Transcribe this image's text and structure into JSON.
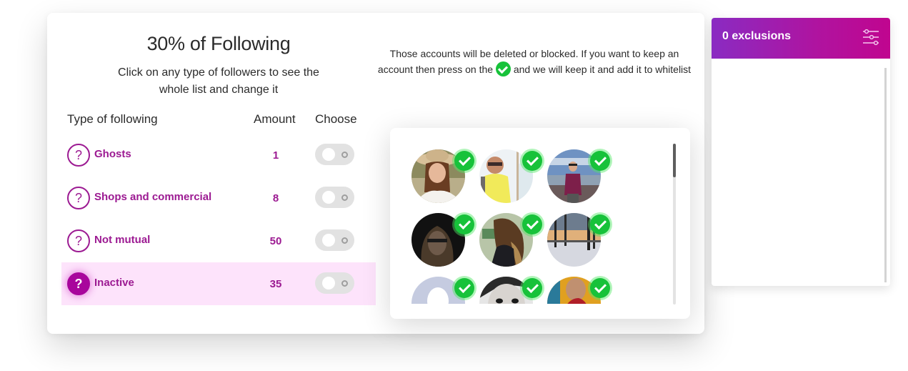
{
  "summary": {
    "title": "30% of Following",
    "subtitle": "Click on any type of followers to see the whole list and change it"
  },
  "table": {
    "headers": {
      "type": "Type of following",
      "amount": "Amount",
      "choose": "Choose"
    },
    "rows": [
      {
        "label": "Ghosts",
        "amount": "1",
        "help_icon": "?",
        "selected": false,
        "toggle_on": false
      },
      {
        "label": "Shops and commercial",
        "amount": "8",
        "help_icon": "?",
        "selected": false,
        "toggle_on": false
      },
      {
        "label": "Not mutual",
        "amount": "50",
        "help_icon": "?",
        "selected": false,
        "toggle_on": false
      },
      {
        "label": "Inactive",
        "amount": "35",
        "help_icon": "?",
        "selected": true,
        "toggle_on": false
      }
    ]
  },
  "info": {
    "text_before": "Those accounts will be deleted or blocked. If you want to keep an account then press on the",
    "icon": "check-circle-icon",
    "text_after": "and we will keep it and add it to whitelist"
  },
  "accounts": {
    "items": [
      {
        "avatar": "woman-in-straw-hat",
        "kept": true
      },
      {
        "avatar": "person-yellow-shirt-beach",
        "kept": true
      },
      {
        "avatar": "man-on-beach",
        "kept": true
      },
      {
        "avatar": "woman-with-glasses-dark",
        "kept": true
      },
      {
        "avatar": "woman-long-hair-park",
        "kept": true
      },
      {
        "avatar": "winter-park-sunset",
        "kept": true
      },
      {
        "avatar": "default-placeholder",
        "kept": true
      },
      {
        "avatar": "woman-black-white",
        "kept": true
      },
      {
        "avatar": "woman-red-colorful",
        "kept": true
      }
    ],
    "scroll_position": 0
  },
  "exclusions": {
    "title": "0 exclusions",
    "count": 0,
    "icon": "filter-sliders-icon"
  },
  "colors": {
    "accent": "#9c1a92",
    "active_row": "#fde3fb",
    "check_green": "#17c23a",
    "header_gradient_start": "#8a2bc2",
    "header_gradient_end": "#c0058f"
  }
}
